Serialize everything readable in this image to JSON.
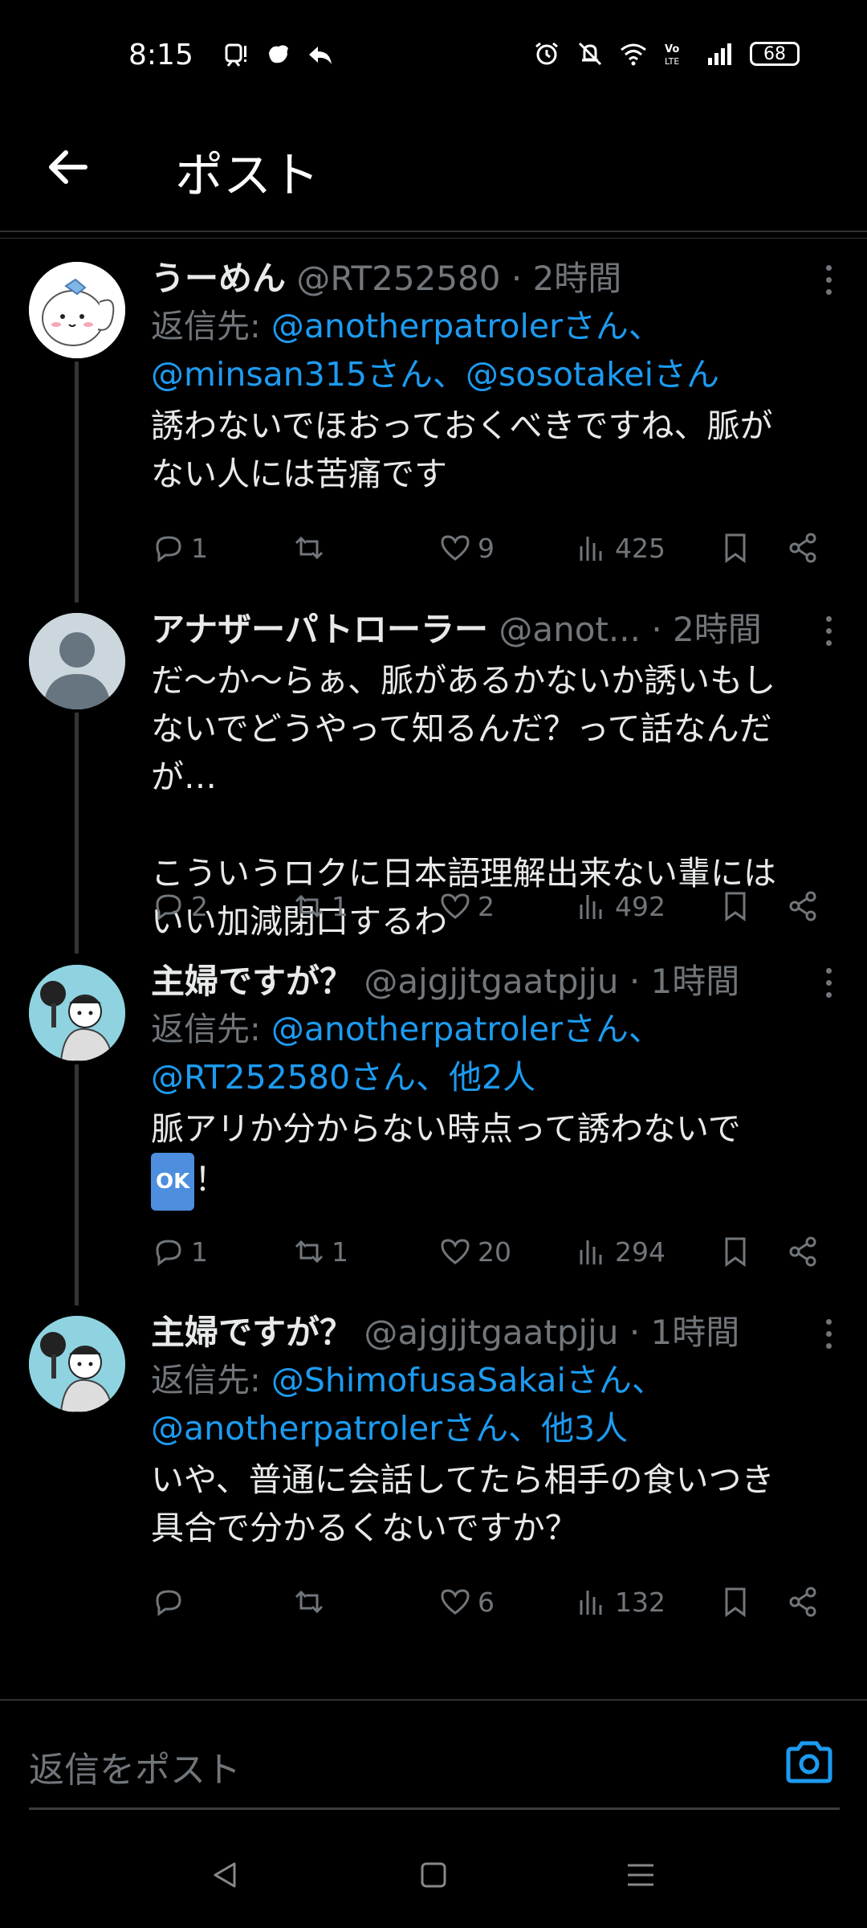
{
  "status_bar": {
    "time": "8:15",
    "battery": "68"
  },
  "header": {
    "title": "ポスト"
  },
  "tweets": [
    {
      "name": "うーめん",
      "handle": "@RT252580",
      "dot": "·",
      "time": "2時間",
      "reply_prefix": "返信先: ",
      "reply_line1": "@anotherpatrolerさん、",
      "reply_line2": "@minsan315さん、@sosotakeiさん",
      "text": "誘わないでほおっておくべきですね、脈が\nない人には苦痛です",
      "replies": "1",
      "retweets": "",
      "likes": "9",
      "views": "425"
    },
    {
      "name": "アナザーパトローラー",
      "handle": "@anot...",
      "dot": "·",
      "time": "2時間",
      "text": "だ〜か〜らぁ、脈があるかないか誘いもし\nないでどうやって知るんだ？って話なんだ\nが…\n\nこういうロクに日本語理解出来ない輩には\nいい加減閉口するわ",
      "replies": "2",
      "retweets": "1",
      "likes": "2",
      "views": "492"
    },
    {
      "name": "主婦ですが？",
      "handle": "@ajgjjtgaatpjju",
      "dot": "·",
      "time": "1時間",
      "reply_prefix": "返信先: ",
      "reply_line1": "@anotherpatrolerさん、",
      "reply_line2": "@RT252580さん、他2人",
      "text_line1": "脈アリか分からない時点って誘わないで",
      "ok_emoji": "OK",
      "text_after_emoji": "！",
      "replies": "1",
      "retweets": "1",
      "likes": "20",
      "views": "294"
    },
    {
      "name": "主婦ですが？",
      "handle": "@ajgjjtgaatpjju",
      "dot": "·",
      "time": "1時間",
      "reply_prefix": "返信先: ",
      "reply_line1": "@ShimofusaSakaiさん、",
      "reply_line2": "@anotherpatrolerさん、他3人",
      "text": "いや、普通に会話してたら相手の食いつき\n具合で分かるくないですか？",
      "replies": "",
      "retweets": "",
      "likes": "6",
      "views": "132"
    }
  ],
  "composer": {
    "placeholder": "返信をポスト"
  },
  "colors": {
    "accent": "#1d9bf0",
    "muted": "#71767b",
    "text": "#e7e9ea",
    "background": "#000000"
  },
  "icons": [
    "back-arrow-icon",
    "more-icon",
    "reply-icon",
    "retweet-icon",
    "like-icon",
    "views-icon",
    "bookmark-icon",
    "share-icon",
    "camera-icon"
  ]
}
